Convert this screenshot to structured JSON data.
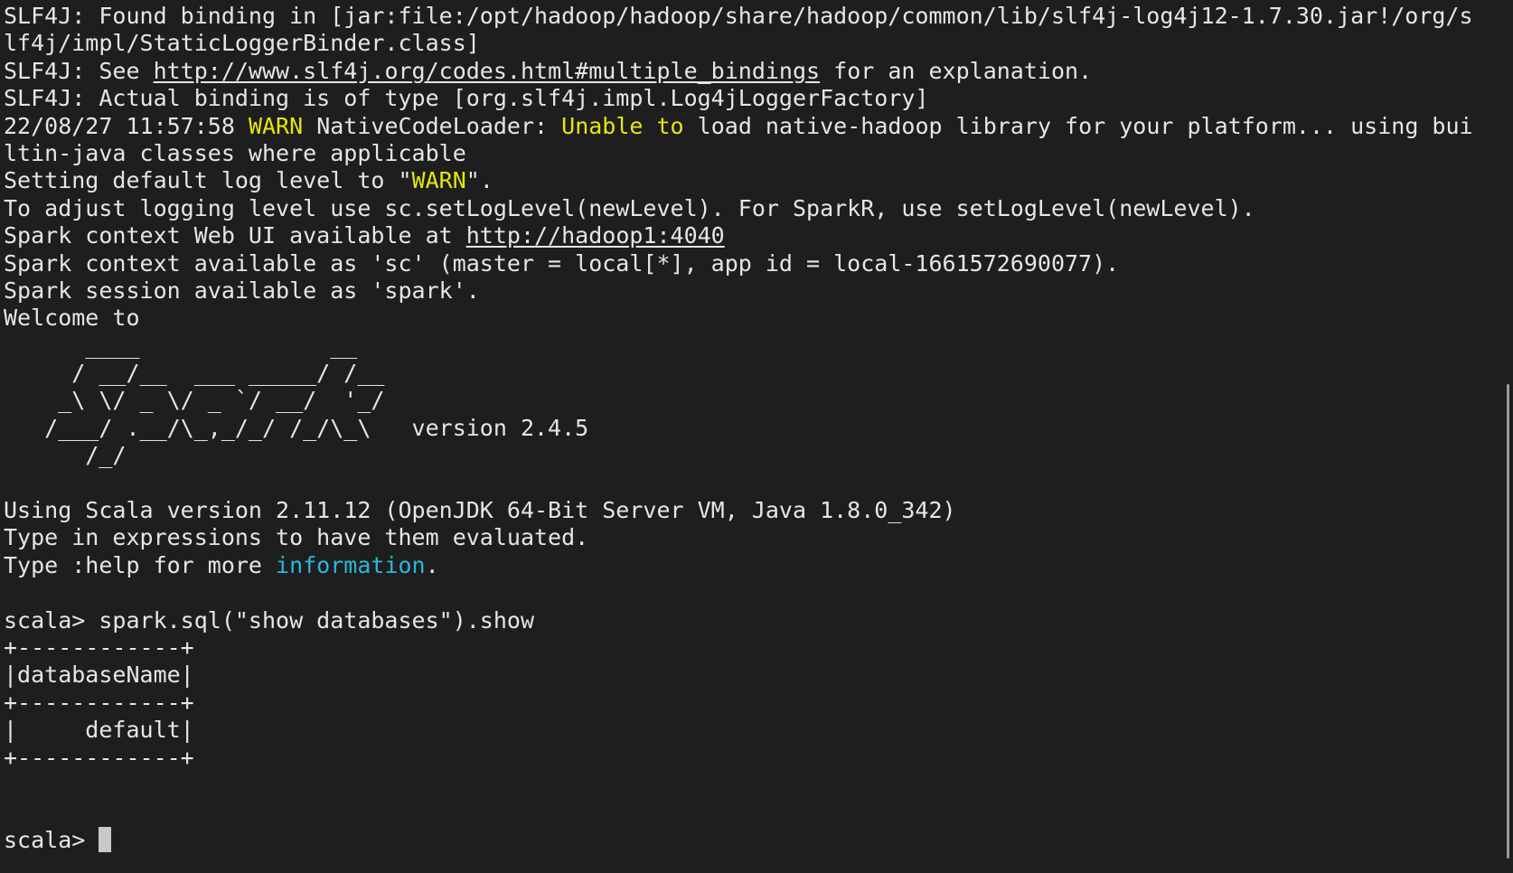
{
  "terminal": {
    "lines": [
      [
        {
          "t": "SLF4J: Found binding in [jar:file:/opt/hadoop/hadoop/share/hadoop/common/lib/slf4j-log4j12-1.7.30.jar!/org/s"
        }
      ],
      [
        {
          "t": "lf4j/impl/StaticLoggerBinder.class]"
        }
      ],
      [
        {
          "t": "SLF4J: See "
        },
        {
          "t": "http://www.slf4j.org/codes.html#multiple_bindings",
          "c": "link"
        },
        {
          "t": " for an explanation."
        }
      ],
      [
        {
          "t": "SLF4J: Actual binding is of type [org.slf4j.impl.Log4jLoggerFactory]"
        }
      ],
      [
        {
          "t": "22/08/27 11:57:58 "
        },
        {
          "t": "WARN",
          "c": "warn"
        },
        {
          "t": " NativeCodeLoader: "
        },
        {
          "t": "Unable to",
          "c": "warn"
        },
        {
          "t": " load native-hadoop library for your platform... using bui"
        }
      ],
      [
        {
          "t": "ltin-java classes where applicable"
        }
      ],
      [
        {
          "t": "Setting default log level to \""
        },
        {
          "t": "WARN",
          "c": "warn"
        },
        {
          "t": "\"."
        }
      ],
      [
        {
          "t": "To adjust logging level use sc.setLogLevel(newLevel). For SparkR, use setLogLevel(newLevel)."
        }
      ],
      [
        {
          "t": "Spark context Web UI available at "
        },
        {
          "t": "http://hadoop1:4040",
          "c": "link"
        }
      ],
      [
        {
          "t": "Spark context available as 'sc' (master = local[*], app id = local-1661572690077)."
        }
      ],
      [
        {
          "t": "Spark session available as 'spark'."
        }
      ],
      [
        {
          "t": "Welcome to"
        }
      ],
      [
        {
          "t": "      ____              __"
        }
      ],
      [
        {
          "t": "     / __/__  ___ _____/ /__"
        }
      ],
      [
        {
          "t": "    _\\ \\/ _ \\/ _ `/ __/  '_/"
        }
      ],
      [
        {
          "t": "   /___/ .__/\\_,_/_/ /_/\\_\\   version 2.4.5"
        }
      ],
      [
        {
          "t": "      /_/"
        }
      ],
      [
        {
          "t": ""
        }
      ],
      [
        {
          "t": "Using Scala version 2.11.12 (OpenJDK 64-Bit Server VM, Java 1.8.0_342)"
        }
      ],
      [
        {
          "t": "Type in expressions to have them evaluated."
        }
      ],
      [
        {
          "t": "Type :help for more "
        },
        {
          "t": "information",
          "c": "info"
        },
        {
          "t": "."
        }
      ],
      [
        {
          "t": ""
        }
      ],
      [
        {
          "t": "scala> spark.sql(\"show databases\").show"
        }
      ],
      [
        {
          "t": "+------------+"
        }
      ],
      [
        {
          "t": "|databaseName|"
        }
      ],
      [
        {
          "t": "+------------+"
        }
      ],
      [
        {
          "t": "|     default|"
        }
      ],
      [
        {
          "t": "+------------+"
        }
      ],
      [
        {
          "t": ""
        }
      ],
      [
        {
          "t": ""
        }
      ],
      [
        {
          "t": "scala> "
        },
        {
          "t": "",
          "c": "cursor"
        }
      ]
    ]
  },
  "colors": {
    "background": "#1e1e1e",
    "foreground": "#e6e6e6",
    "warn": "#e5e510",
    "info": "#29b8db"
  }
}
